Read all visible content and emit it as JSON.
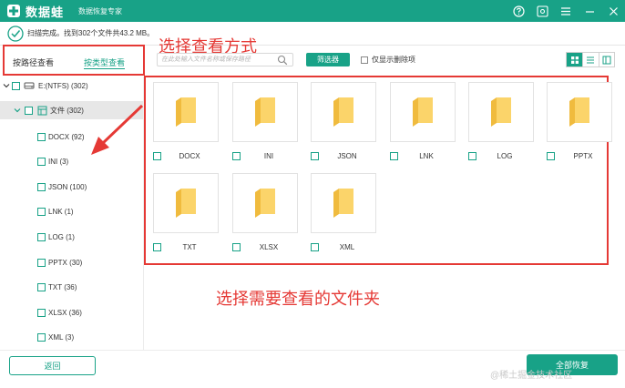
{
  "titlebar": {
    "app_name": "数据蛙",
    "subtitle": "数据恢复专家",
    "brand_color": "#18a287",
    "controls": [
      "help-icon",
      "settings-icon",
      "menu-icon",
      "minimize-icon",
      "close-icon"
    ]
  },
  "status": {
    "text": "扫描完成。找到302个文件共43.2 MB。"
  },
  "left_panel": {
    "tab_by_path": "按路径查看",
    "tab_by_type": "按类型查看",
    "tree": [
      {
        "label": "E:(NTFS) (302)",
        "icon": "drive-icon",
        "expanded": true
      },
      {
        "label": "文件 (302)",
        "icon": "file-type-icon",
        "expanded": true,
        "selected": true
      },
      {
        "label": "DOCX (92)"
      },
      {
        "label": "INI (3)"
      },
      {
        "label": "JSON (100)"
      },
      {
        "label": "LNK (1)"
      },
      {
        "label": "LOG (1)"
      },
      {
        "label": "PPTX (30)"
      },
      {
        "label": "TXT (36)"
      },
      {
        "label": "XLSX (36)"
      },
      {
        "label": "XML (3)"
      }
    ]
  },
  "toolbar": {
    "search_placeholder": "在此处输入文件名称或保存路径",
    "filter_label": "筛选器",
    "deleted_only_label": "仅显示删除项",
    "view_modes": [
      "grid-view-icon",
      "list-view-icon",
      "detail-view-icon"
    ],
    "active_view": "grid-view-icon"
  },
  "folders": [
    {
      "label": "DOCX"
    },
    {
      "label": "INI"
    },
    {
      "label": "JSON"
    },
    {
      "label": "LNK"
    },
    {
      "label": "LOG"
    },
    {
      "label": "PPTX"
    },
    {
      "label": "TXT"
    },
    {
      "label": "XLSX"
    },
    {
      "label": "XML"
    }
  ],
  "annotations": {
    "choose_view_mode": "选择查看方式",
    "choose_folder": "选择需要查看的文件夹",
    "color": "#e53935"
  },
  "footer": {
    "back_label": "返回",
    "restore_all_label": "全部恢复",
    "watermark": "@稀土掘金技术社区"
  }
}
